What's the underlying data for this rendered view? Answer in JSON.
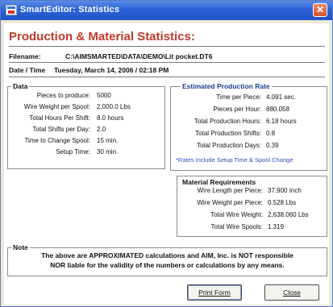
{
  "window": {
    "title": "SmartEditor: Statistics",
    "close_glyph": "✕"
  },
  "header": {
    "title": "Production & Material Statistics:"
  },
  "file": {
    "filename_label": "Filename:",
    "filename_value": "C:\\AIMSMARTED\\DATA\\DEMO\\Lit pocket.DT6",
    "date_label": "Date / Time",
    "date_value": "Tuesday, March 14, 2006  /  02:18 PM"
  },
  "data_group": {
    "legend": "Data",
    "rows": [
      {
        "label": "Pieces to produce:",
        "value": "5000"
      },
      {
        "label": "Wire Weight per Spool:",
        "value": "2,000.0 Lbs"
      },
      {
        "label": "Total Hours Per Shift:",
        "value": "8.0 hours"
      },
      {
        "label": "Total Shifts per Day:",
        "value": "2.0"
      },
      {
        "label": "Time to Change Spool:",
        "value": "15 min."
      },
      {
        "label": "Setup Time:",
        "value": "30 min."
      }
    ]
  },
  "production_group": {
    "legend": "Estimated Production Rate",
    "rows": [
      {
        "label": "Time per Piece:",
        "value": "4.091 sec."
      },
      {
        "label": "Pieces per Hour:",
        "value": "880.058"
      },
      {
        "label": "Total Production Hours:",
        "value": "6.18 hours"
      },
      {
        "label": "Total Production Shifts:",
        "value": "0.8"
      },
      {
        "label": "Total Production Days:",
        "value": "0.39"
      }
    ],
    "footnote": "*Rates Include Setup Time & Spool Change"
  },
  "material_group": {
    "legend": "Material Requirements",
    "rows": [
      {
        "label": "Wire Length per Piece:",
        "value": "37.900 Inch"
      },
      {
        "label": "Wire Weight per Piece:",
        "value": "0.528 Lbs"
      },
      {
        "label": "Total Wire Weight:",
        "value": "2,638.060 Lbs"
      },
      {
        "label": "Total Wire Spools:",
        "value": "1.319"
      }
    ]
  },
  "note": {
    "legend": "Note",
    "line1": "The above are APPROXIMATED calculations and AIM, Inc. is NOT responsible",
    "line2": "NOR liable for the validity of the numbers or calculations by any means."
  },
  "buttons": {
    "print": "Print Form",
    "close": "Close"
  },
  "colors": {
    "titlebar": "#2d63d8",
    "header": "#c0392b",
    "legend_blue": "#1c3c8c",
    "footnote": "#2f4fc0"
  }
}
